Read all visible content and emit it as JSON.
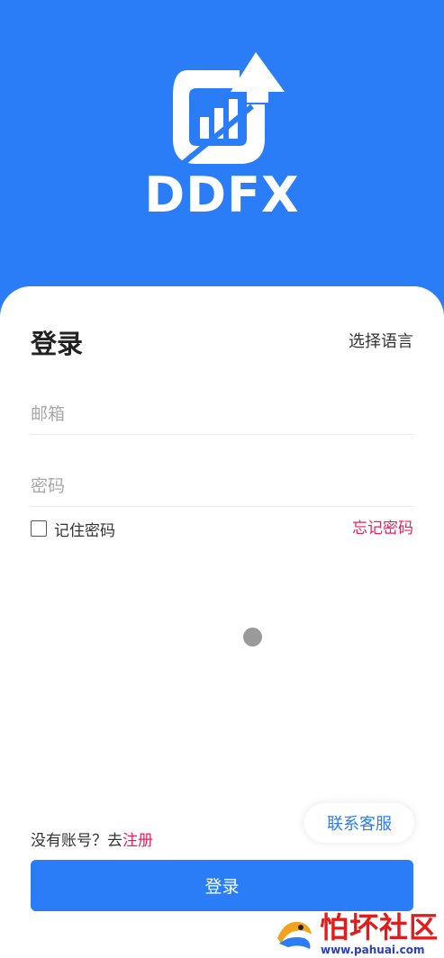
{
  "brand": {
    "name": "DDFX"
  },
  "login": {
    "title": "登录",
    "language_label": "选择语言",
    "email_placeholder": "邮箱",
    "password_placeholder": "密码",
    "remember_label": "记住密码",
    "forgot_label": "忘记密码",
    "contact_label": "联系客服",
    "no_account_text": "没有账号？去",
    "register_label": "注册",
    "submit_label": "登录"
  },
  "watermark": {
    "text": "怕坏社区",
    "url": "www.pahuai.com"
  },
  "colors": {
    "primary": "#2a7df6",
    "accent_red": "#e5225f",
    "card": "#ffffff"
  },
  "icons": [
    "ddfx-logo-icon",
    "checkbox-icon",
    "loading-spinner-icon",
    "watermark-logo-icon"
  ]
}
